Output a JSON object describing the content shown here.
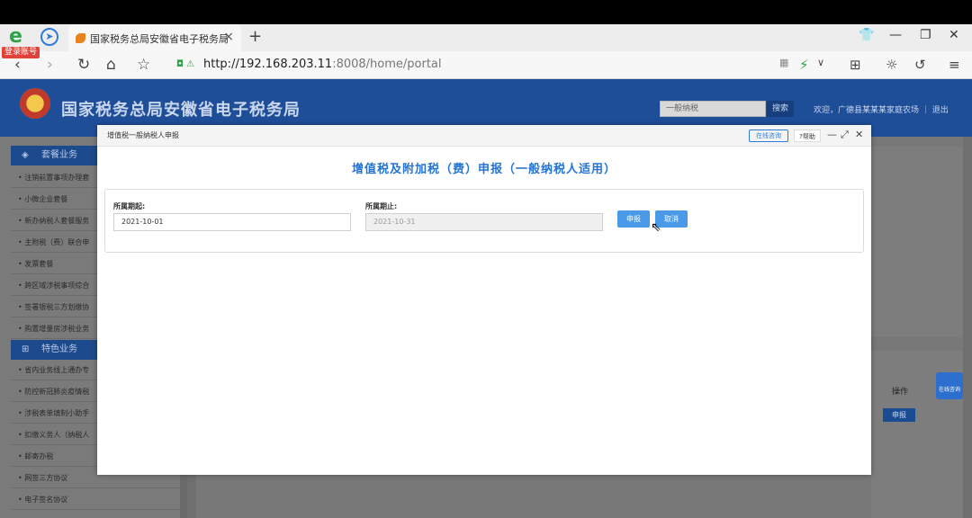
{
  "browser": {
    "login_badge": "登录账号",
    "tab_title": "国家税务总局安徽省电子税务局",
    "url_main": "http://192.168.203.11",
    "url_rest": ":8008/home/portal"
  },
  "site": {
    "title": "国家税务总局安徽省电子税务局",
    "search_placeholder": "一般纳税",
    "search_button": "搜索",
    "welcome": "欢迎，广德县某某某家庭农场 ｜ 退出"
  },
  "sidebar": {
    "groups": [
      {
        "label": "套餐业务",
        "items": [
          "注销前置事项办理套",
          "小微企业套餐",
          "新办纳税人套餐服务",
          "主附税（费）联合申",
          "发票套餐",
          "跨区域涉税事项综合",
          "签署银税三方划缴协",
          "购置增量房涉税业务"
        ]
      },
      {
        "label": "特色业务",
        "items": [
          "省内业务线上通办专",
          "防控新冠肺炎疫情税",
          "涉税表单填制小助手",
          "扣缴义务人（纳税人",
          "邮寄办税",
          "网签三方协议",
          "电子签名协议"
        ]
      }
    ]
  },
  "background": {
    "op_header": "操作",
    "shenbao_button": "申报",
    "service_float": "在线咨询"
  },
  "modal": {
    "title": "增值税一般纳税人申报",
    "online_btn": "在线咨询",
    "help_btn": "?帮助",
    "heading": "增值税及附加税（费）申报（一般纳税人适用）",
    "period_start_label": "所属期起:",
    "period_start_value": "2021-10-01",
    "period_end_label": "所属期止:",
    "period_end_value": "2021-10-31",
    "declare_button": "申报",
    "cancel_button": "取消"
  }
}
